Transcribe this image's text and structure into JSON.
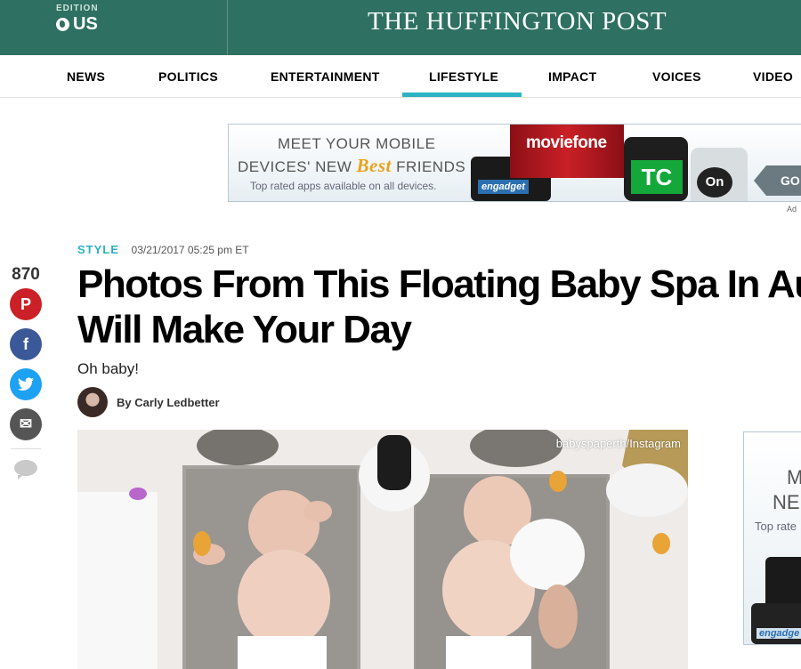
{
  "header": {
    "edition_label": "EDITION",
    "edition_value": "US",
    "logo": "THE HUFFINGTON POST"
  },
  "nav": {
    "items": [
      "NEWS",
      "POLITICS",
      "ENTERTAINMENT",
      "LIFESTYLE",
      "IMPACT",
      "VOICES",
      "VIDEO"
    ],
    "active": "LIFESTYLE"
  },
  "ad_banner": {
    "line1": "MEET YOUR MOBILE",
    "line2_prefix": "DEVICES' NEW",
    "line2_highlight": "Best",
    "line2_suffix": "FRIENDS",
    "line3": "Top rated apps available on all devices.",
    "moviefone": "moviefone",
    "engadget": "engadget",
    "techcrunch": "TC",
    "on": "On",
    "cta": "GO",
    "choices_label": "Ad"
  },
  "article": {
    "section": "STYLE",
    "timestamp": "03/21/2017 05:25 pm ET",
    "headline_line1": "Photos From This Floating Baby Spa In Aus",
    "headline_line2": "Will Make Your Day",
    "subhead": "Oh baby!",
    "author": "By Carly Ledbetter",
    "photo_credit": "babyspaperth/Instagram"
  },
  "share": {
    "count": "870",
    "buttons": [
      {
        "name": "pinterest",
        "glyph": "P",
        "color": "#cb2027"
      },
      {
        "name": "facebook",
        "glyph": "f",
        "color": "#3b5998"
      },
      {
        "name": "twitter",
        "glyph": "t",
        "color": "#1da1f2"
      },
      {
        "name": "email",
        "glyph": "✉",
        "color": "#555555"
      }
    ]
  },
  "side_ad": {
    "line1": "M",
    "line2": "NE",
    "line3": "Top rate",
    "engadget": "engadge"
  },
  "colors": {
    "header_bg": "#2e7061",
    "accent": "#2bb2c3"
  }
}
